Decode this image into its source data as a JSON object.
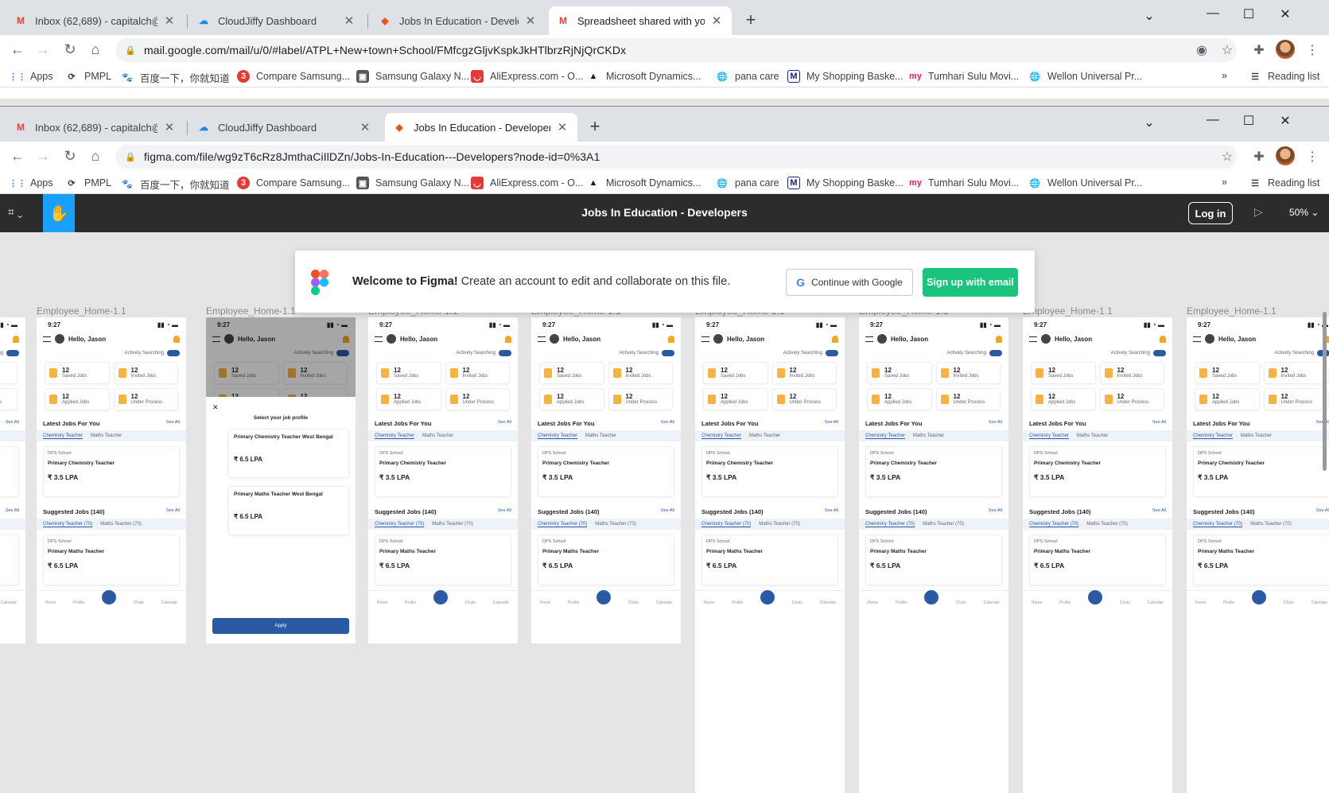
{
  "back_window": {
    "tabs": [
      {
        "title": "Inbox (62,689) - capitalch@gmail",
        "icon": "gmail-icon"
      },
      {
        "title": "CloudJiffy Dashboard",
        "icon": "cloudjiffy-icon"
      },
      {
        "title": "Jobs In Education - Developers –",
        "icon": "figma-icon"
      },
      {
        "title": "Spreadsheet shared with you: \"JI",
        "icon": "gmail-icon"
      }
    ],
    "url": "mail.google.com/mail/u/0/#label/ATPL+New+town+School/FMfcgzGljvKspkJkHTlbrzRjNjQrCKDx"
  },
  "front_window": {
    "tabs": [
      {
        "title": "Inbox (62,689) - capitalch@gmail",
        "icon": "gmail-icon"
      },
      {
        "title": "CloudJiffy Dashboard",
        "icon": "cloudjiffy-icon"
      },
      {
        "title": "Jobs In Education - Developers –",
        "icon": "figma-icon"
      }
    ],
    "url": "figma.com/file/wg9zT6cRz8JmthaCiIlDZn/Jobs-In-Education---Developers?node-id=0%3A1"
  },
  "bookmarks": [
    "Apps",
    "PMPL",
    "百度一下，你就知道",
    "Compare Samsung...",
    "Samsung Galaxy N...",
    "AliExpress.com - O...",
    "Microsoft Dynamics...",
    "pana care",
    "My Shopping Baske...",
    "Tumhari Sulu Movi...",
    "Wellon Universal Pr..."
  ],
  "reading_list": "Reading list",
  "figma": {
    "file_title": "Jobs In Education - Developers",
    "login": "Log in",
    "zoom": "50%",
    "welcome_bold": "Welcome to Figma!",
    "welcome_text": " Create an account to edit and collaborate on this file.",
    "google_btn": "Continue with Google",
    "email_btn": "Sign up with email",
    "frame_label": "Employee_Home-1.1"
  },
  "frame": {
    "time": "9:27",
    "greeting": "Hello, Jason",
    "actively": "Actively Searching",
    "stats": [
      {
        "value": "12",
        "label": "Saved Jobs"
      },
      {
        "value": "12",
        "label": "Invited Jobs"
      },
      {
        "value": "12",
        "label": "Applied Jobs"
      },
      {
        "value": "12",
        "label": "Under Process"
      }
    ],
    "latest": "Latest Jobs For You",
    "see_all": "See All",
    "tab1": "Chemistry Teacher",
    "tab2": "Maths Teacher",
    "school": "DPS School",
    "job1": "Primary Chemistry Teacher",
    "salary1": "₹ 3.5 LPA",
    "suggested": "Suggested Jobs (140)",
    "stab1": "Chemistry Teacher (70)",
    "stab2": "Maths Teacher (70)",
    "job2": "Primary Maths Teacher",
    "salary2": "₹ 6.5 LPA",
    "nav": [
      "Home",
      "Profile",
      "Find A Job",
      "Chats",
      "Calendar"
    ],
    "modal_title": "Select your job profile",
    "opt1": "Primary Chemistry Teacher West Bengal",
    "opt2": "Primary Maths Teacher West Bengal",
    "apply": "Apply"
  }
}
